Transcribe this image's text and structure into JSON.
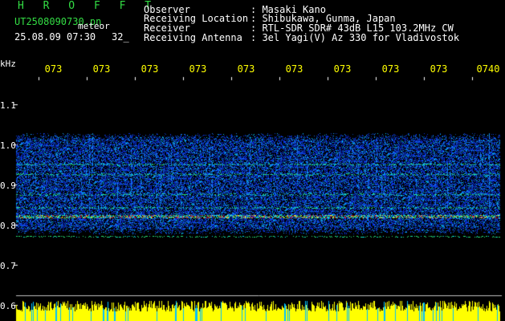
{
  "header": {
    "station": "H R O F F T",
    "filename": "UT2508090730.pn",
    "tag": "meteor",
    "datetime": "25.08.09 07:30",
    "count": "32_",
    "observer_label": "Observer",
    "observer_value": ": Masaki Kano",
    "location_label": "Receiving Location",
    "location_value": ": Shibukawa, Gunma, Japan",
    "receiver_label": "Receiver",
    "receiver_value": ": RTL-SDR SDR# 43dB L15 103.2MHz CW",
    "antenna_label": "Receiving Antenna",
    "antenna_value": ": 3el Yagi(V) Az 330 for Vladivostok"
  },
  "spectrogram": {
    "y_unit": "kHz",
    "y_ticks": [
      "1.1",
      "1.0",
      "0.9",
      "0.8",
      "0.7",
      "0.6"
    ],
    "x_ticks": [
      "073",
      "073",
      "073",
      "073",
      "073",
      "073",
      "073",
      "073",
      "073",
      "0740"
    ],
    "bands_khz": [
      0.82,
      0.842,
      0.875,
      0.925,
      0.95,
      0.77
    ],
    "colors": {
      "background": "#000000",
      "noise": "#1030c0",
      "signal": "#00e0ff",
      "strong": "#ff3030",
      "level_bar": "#ffff00",
      "level_bar_alt": "#00c0ff",
      "axis_text": "#ffff00",
      "label_text": "#ffffff",
      "title_text": "#33dd44"
    }
  }
}
